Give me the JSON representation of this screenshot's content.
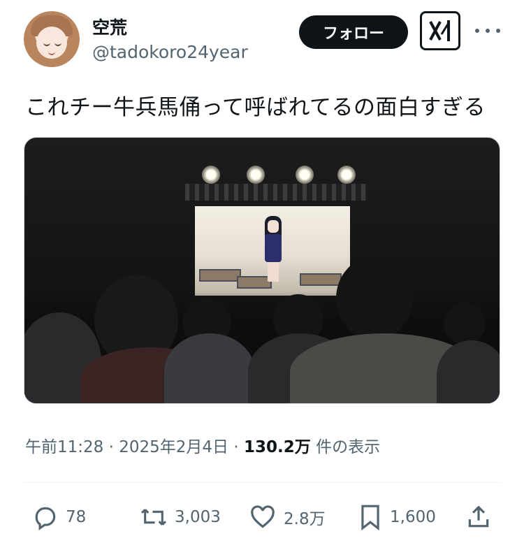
{
  "author": {
    "display_name": "空荒",
    "handle": "@tadokoro24year"
  },
  "header": {
    "follow_label": "フォロー"
  },
  "tweet": {
    "text": "これチー牛兵馬俑って呼ばれてるの面白すぎる"
  },
  "meta": {
    "time": "午前11:28",
    "sep1": "·",
    "date": "2025年2月4日",
    "sep2": "·",
    "views": "130.2万",
    "views_suffix": "件の表示"
  },
  "actions": {
    "reply": {
      "icon": "reply-icon",
      "count": "78"
    },
    "retweet": {
      "icon": "retweet-icon",
      "count": "3,003"
    },
    "like": {
      "icon": "heart-icon",
      "count": "2.8万"
    },
    "bookmark": {
      "icon": "bookmark-icon",
      "count": "1,600"
    },
    "share": {
      "icon": "share-icon"
    }
  },
  "colors": {
    "text": "#0f1419",
    "secondary": "#536471",
    "button_bg": "#0f1419"
  }
}
